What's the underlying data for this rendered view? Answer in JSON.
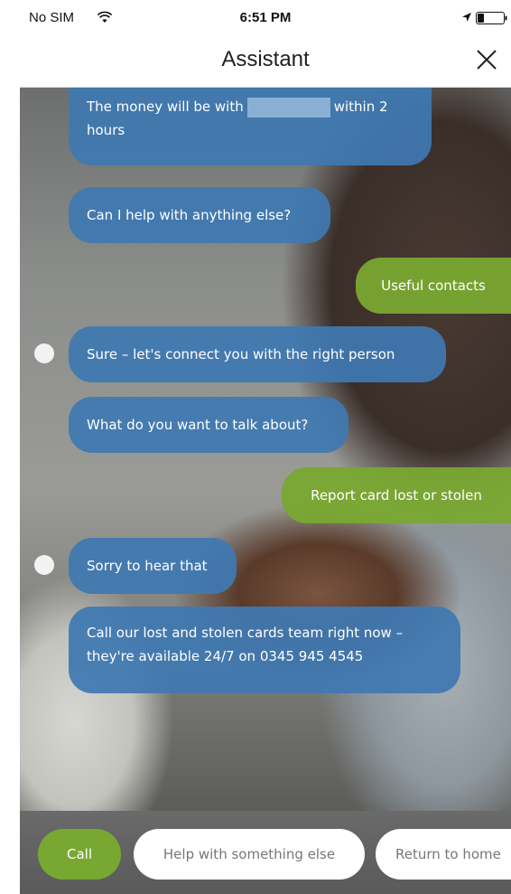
{
  "status_bar": {
    "carrier": "No SIM",
    "time": "6:51 PM",
    "icons": [
      "wifi-icon",
      "location-icon",
      "battery-icon"
    ]
  },
  "header": {
    "title": "Assistant",
    "close_icon": "close-icon"
  },
  "messages": [
    {
      "from": "bot",
      "text_before": "The money will be with",
      "text_after": "within 2",
      "text_line2": "hours",
      "redacted": true
    },
    {
      "from": "bot",
      "text": "Can I help with anything else?"
    },
    {
      "from": "user",
      "text": "Useful contacts"
    },
    {
      "from": "bot",
      "text": "Sure – let's connect you with the right person",
      "avatar": true
    },
    {
      "from": "bot",
      "text": "What do you want to talk about?"
    },
    {
      "from": "user",
      "text": "Report card lost or stolen"
    },
    {
      "from": "bot",
      "text": "Sorry to hear that",
      "avatar": true
    },
    {
      "from": "bot",
      "text_line1": "Call our lost and stolen cards team right now –",
      "text_line2": "they're available 24/7 on 0345 945 4545"
    }
  ],
  "actions": {
    "call": "Call",
    "help": "Help with something else",
    "home": "Return to home"
  },
  "colors": {
    "bot_bubble": "#4078B2",
    "user_bubble": "#79A832",
    "call_button": "#79A832"
  }
}
